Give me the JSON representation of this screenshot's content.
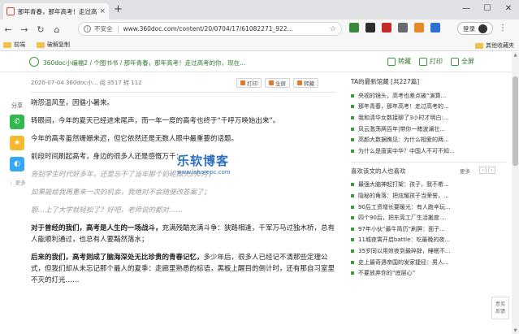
{
  "browser": {
    "tab_title": "那年青春，那年高考！走过高考...",
    "tab_close": "×",
    "new_tab": "+",
    "win_min": "—",
    "win_max": "☐",
    "win_close": "✕",
    "not_secure": "不安全",
    "url": "www.360doc.com/content/20/0704/17/61082271_922...",
    "login": "登录",
    "menu": "⋮",
    "bookmarks": [
      "前端",
      "破解复制"
    ],
    "other_bookmarks": "其他收藏夹"
  },
  "site": {
    "breadcrumb": "360doc小编福2 / 个图书书 / 那年青春，那年高考！走过高考的你，现在...",
    "actions": [
      "转藏",
      "打印",
      "全屏"
    ]
  },
  "share": {
    "label": "分享",
    "buttons": [
      {
        "name": "wechat",
        "glyph": "✆",
        "color": "#2fb84c"
      },
      {
        "name": "favorite",
        "glyph": "★",
        "color": "#f5b82e"
      },
      {
        "name": "qq",
        "glyph": "◐",
        "color": "#34a8f2"
      }
    ],
    "more": "⋮ 更多"
  },
  "article": {
    "meta": "2020-07-04  360doc小...  阅 3517  转 112",
    "btn_print": "打印",
    "btn_full": "全屏",
    "btn_save": "转藏",
    "paragraphs": [
      "晓怨温风至，因循小暑来。",
      "转眼间，今年的夏天已经进来尾声，而一年一度的高考也终于“千呼万唤始出来”。",
      "今年的高考虽然姗姗来迟，但它依然还是无数人眼中最重要的话题。",
      "前段时间刷起高考，身边的很多人还是感慨万千："
    ],
    "gray_paragraphs": [
      "告别学生时代好多年，还是忘不了当年那个奶昵拟火的6月；",
      "如果能给我再重来一次的机会，我绝对不会随便改答案了；",
      "额…上了大学就轻松了？好吧，老师说的都对……"
    ],
    "bold1_strong": "对于曾经的我们，高考是人生的一场战斗，",
    "bold1_rest": "充满残酷充满斗争：狭路相逢，千军万马过独木桥，总有人能顺利通过，也总有人要黯然落水；",
    "bold2_strong": "后来的我们，高考则成了脑海深处无比珍贵的青春记忆，",
    "bold2_rest": "多少年后，很多人已经记不清那些定理公式，但我们却从未忘记那个最人的夏季：走廊里熟悉的标语，黑板上醒目的倒计时，还有那自习室里不灭的灯光……"
  },
  "watermark": {
    "big": "乐软博客",
    "small": "www.isharepc.com"
  },
  "sidebar": {
    "title1": "TA的最新馆藏  [共227篇]",
    "list1": [
      "央视的镜头，高考也差点被“演算...",
      "那年青春，那年高考！走过高考的...",
      "我和清华女数接聊了3小时才明白:...",
      "风云激荡两百年|带你一睹波澜壮...",
      "高颜大数据瞧见：为什么相爱的两...",
      "为什么是唐寅中华？中国人不可不知..."
    ],
    "title2": "喜欢该文的人也喜欢",
    "more": "更多",
    "list2": [
      "最强大脑神起打架：孩子，我不希...",
      "隐秘的角落：把炫耀孩子当荣誉，...",
      "90后工资增长要暖光：有人跑辛玩...",
      "四个90后，把东莞工厂生活搬度...",
      "97年小伙“最牛简历”刷屏：面子...",
      "11城夜霄开启battle：吃最晚的夜...",
      "35岁同以用效夜到最碎辞，睡眠不...",
      "史上最奇遇帝国的发家捷径：男人...",
      "不要放弃你的“底层心”"
    ]
  },
  "feedback": {
    "line1": "意见",
    "line2": "反馈"
  }
}
